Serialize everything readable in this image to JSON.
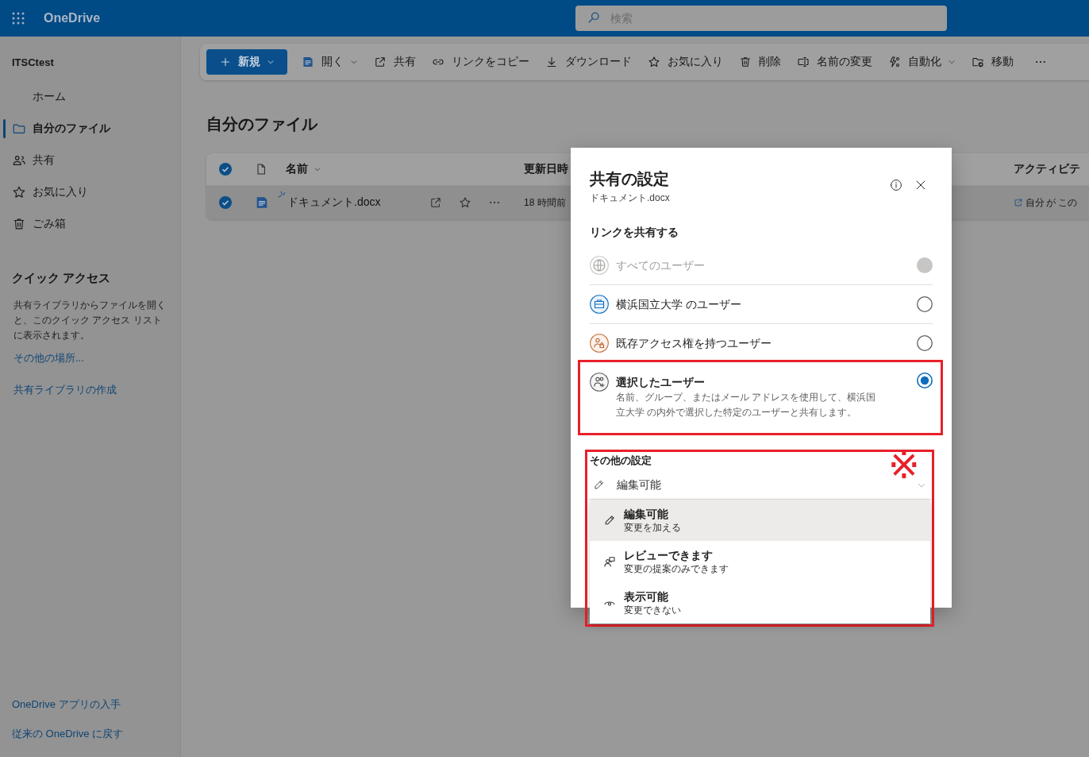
{
  "app_bar": {
    "app_name": "OneDrive",
    "search": {
      "placeholder": "検索"
    }
  },
  "sidebar": {
    "account": "ITSCtest",
    "nav": [
      {
        "label": "ホーム",
        "selected": false
      },
      {
        "label": "自分のファイル",
        "selected": true
      },
      {
        "label": "共有",
        "selected": false
      },
      {
        "label": "お気に入り",
        "selected": false
      },
      {
        "label": "ごみ箱",
        "selected": false
      }
    ],
    "quick_access": {
      "title": "クイック アクセス",
      "description": "共有ライブラリからファイルを開くと、このクイック アクセス リストに表示されます。",
      "links": [
        "その他の場所...",
        "共有ライブラリの作成"
      ]
    },
    "footer_links": [
      "OneDrive アプリの入手",
      "従来の OneDrive に戻す"
    ]
  },
  "toolbar": {
    "items": [
      {
        "label": "新規",
        "kind": "primary",
        "has_menu": true
      },
      {
        "label": "開く",
        "kind": "command",
        "has_menu": true
      },
      {
        "label": "共有",
        "kind": "command",
        "has_menu": false
      },
      {
        "label": "リンクをコピー",
        "kind": "command",
        "has_menu": false
      },
      {
        "label": "ダウンロード",
        "kind": "command",
        "has_menu": false
      },
      {
        "label": "お気に入り",
        "kind": "command",
        "has_menu": false
      },
      {
        "label": "削除",
        "kind": "command",
        "has_menu": false
      },
      {
        "label": "名前の変更",
        "kind": "command",
        "has_menu": false
      },
      {
        "label": "自動化",
        "kind": "command",
        "has_menu": true
      },
      {
        "label": "移動",
        "kind": "command",
        "has_menu": false
      }
    ]
  },
  "page_title": "自分のファイル",
  "file_table": {
    "all_selected": true,
    "columns": [
      {
        "label": "名前",
        "has_menu": true
      },
      {
        "label": "更新日時",
        "has_menu": false
      },
      {
        "label": "アクティビテ",
        "has_menu": false
      }
    ],
    "rows": [
      {
        "name": "ドキュメント.docx",
        "selected": true,
        "new": true,
        "modified": "18 時間前",
        "activity": "自分 が この"
      }
    ]
  },
  "share_dialog": {
    "title": "共有の設定",
    "file_name": "ドキュメント.docx",
    "section_label": "リンクを共有する",
    "options": [
      {
        "label": "すべてのユーザー",
        "disabled": true,
        "selected": false,
        "highlighted": false
      },
      {
        "label": "横浜国立大学 のユーザー",
        "disabled": false,
        "selected": false,
        "highlighted": false
      },
      {
        "label": "既存アクセス権を持つユーザー",
        "disabled": false,
        "selected": false,
        "highlighted": false
      },
      {
        "label": "選択したユーザー",
        "description": "名前、グループ、またはメール アドレスを使用して、横浜国立大学 の内外で選択した特定のユーザーと共有します。",
        "disabled": false,
        "selected": true,
        "highlighted": true
      }
    ],
    "other_settings": {
      "label": "その他の設定",
      "highlighted": true,
      "annotation_mark": "※",
      "permission": {
        "value": "編集可能",
        "expanded": true,
        "options": [
          {
            "title": "編集可能",
            "description": "変更を加える",
            "selected": true
          },
          {
            "title": "レビューできます",
            "description": "変更の提案のみできます",
            "selected": false
          },
          {
            "title": "表示可能",
            "description": "変更できない",
            "selected": false
          }
        ]
      }
    }
  }
}
